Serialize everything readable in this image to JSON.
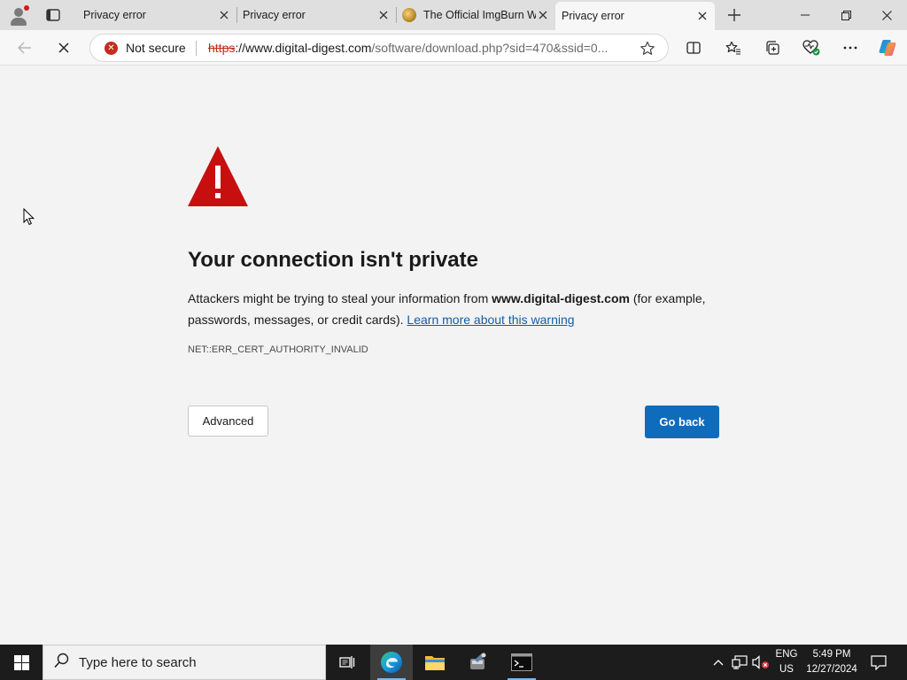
{
  "browser": {
    "tabs": [
      {
        "title": "Privacy error",
        "active": false
      },
      {
        "title": "Privacy error",
        "active": false
      },
      {
        "title": "The Official ImgBurn W",
        "active": false
      },
      {
        "title": "Privacy error",
        "active": true
      }
    ],
    "address": {
      "security_label": "Not secure",
      "url_scheme": "https",
      "url_host": "://www.digital-digest.com",
      "url_path": "/software/download.php?sid=470&ssid=0..."
    }
  },
  "page": {
    "heading": "Your connection isn't private",
    "desc_prefix": "Attackers might be trying to steal your information from ",
    "desc_host": "www.digital-digest.com",
    "desc_middle": " (for example, passwords, messages, or credit cards). ",
    "learn_more": "Learn more about this warning",
    "error_code": "NET::ERR_CERT_AUTHORITY_INVALID",
    "advanced_label": "Advanced",
    "go_back_label": "Go back"
  },
  "taskbar": {
    "search_placeholder": "Type here to search",
    "language_line1": "ENG",
    "language_line2": "US",
    "time": "5:49 PM",
    "date": "12/27/2024"
  },
  "colors": {
    "warning_red": "#c80f0f",
    "accent_blue": "#0f6cbd",
    "link_blue": "#0f5fa8"
  }
}
